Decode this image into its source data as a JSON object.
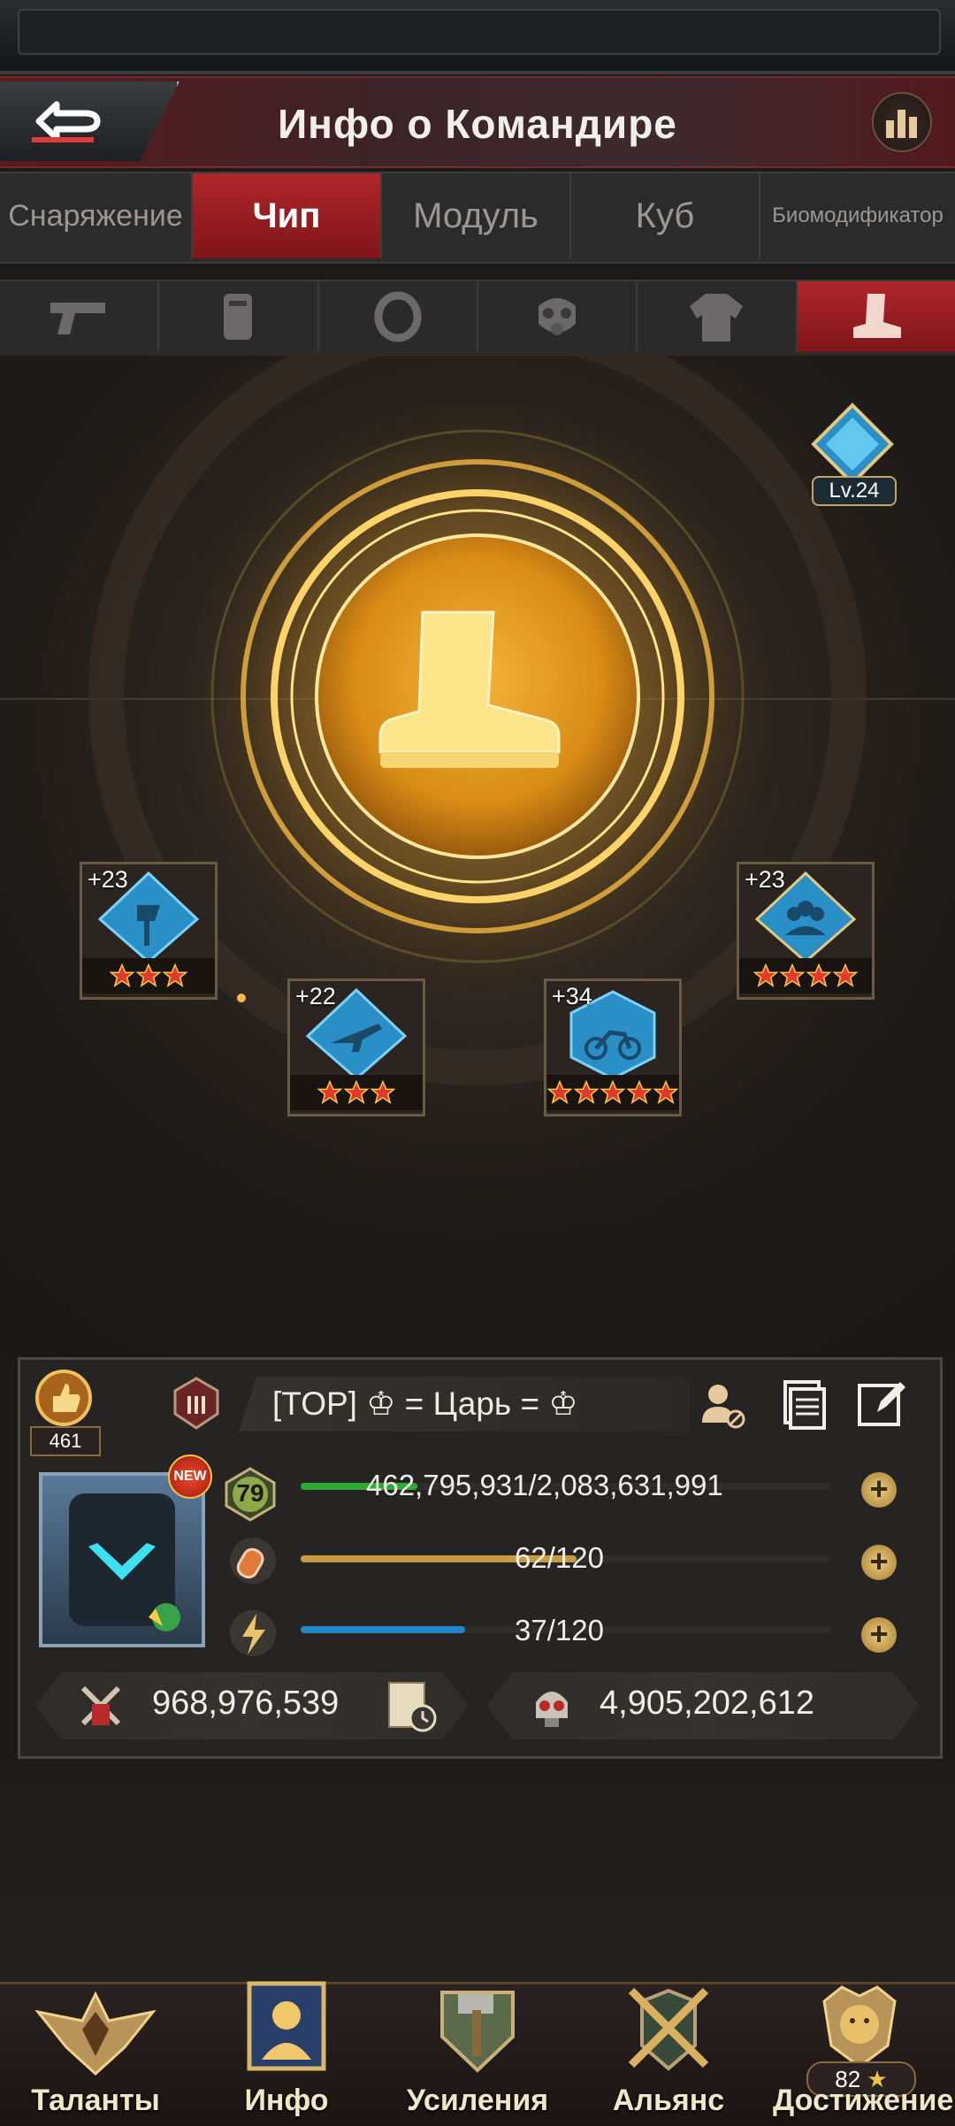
{
  "header": {
    "title": "Инфо о Командире"
  },
  "tabs": [
    {
      "label": "Снаряжение",
      "active": false
    },
    {
      "label": "Чип",
      "active": true
    },
    {
      "label": "Модуль",
      "active": false
    },
    {
      "label": "Куб",
      "active": false
    },
    {
      "label": "Биомодификатор",
      "active": false
    }
  ],
  "equipment_slots": [
    "pistol-icon",
    "armor-plate-icon",
    "ring-icon",
    "gas-mask-icon",
    "jacket-icon",
    "boot-icon"
  ],
  "selected_slot": "boot-icon",
  "level_badge": "Lv.24",
  "chips": [
    {
      "level": "+23",
      "stars": 3
    },
    {
      "level": "+22",
      "stars": 3
    },
    {
      "level": "+34",
      "stars": 5
    },
    {
      "level": "+23",
      "stars": 4
    }
  ],
  "profile": {
    "badge_count": "461",
    "name": "[TOP] ♔ = Царь = ♔",
    "level": "79",
    "new_label": "NEW",
    "exp": "462,795,931/2,083,631,991",
    "exp_fraction": 0.22,
    "stamina": "62/120",
    "stamina_fraction": 0.52,
    "energy": "37/120",
    "energy_fraction": 0.31,
    "power": "968,976,539",
    "kills": "4,905,202,612"
  },
  "nav": [
    {
      "label": "Таланты"
    },
    {
      "label": "Инфо"
    },
    {
      "label": "Усиления"
    },
    {
      "label": "Альянс"
    },
    {
      "label": "Достижение",
      "count": "82"
    }
  ],
  "colors": {
    "accent_red": "#b0262a",
    "gold": "#f0b42a",
    "exp_bar": "#2faa3a",
    "stamina_bar": "#c79a45",
    "energy_bar": "#1f86c9"
  }
}
